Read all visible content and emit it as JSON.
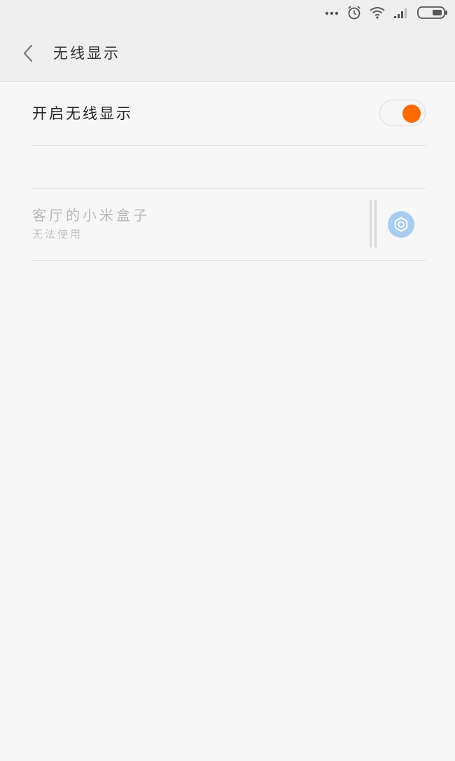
{
  "status_bar": {
    "icons": [
      "more-dots-icon",
      "alarm-icon",
      "wifi-icon",
      "signal-icon",
      "battery-icon"
    ]
  },
  "header": {
    "title": "无线显示",
    "back_icon": "chevron-left-icon"
  },
  "wireless_display_toggle": {
    "label": "开启无线显示",
    "enabled": true
  },
  "devices": [
    {
      "name": "客厅的小米盒子",
      "status": "无法使用",
      "settings_icon": "gear-icon"
    }
  ],
  "colors": {
    "accent": "#ff6a00",
    "settings_button": "#a9cdf0",
    "background": "#f7f7f7",
    "header_background": "#efefef"
  }
}
